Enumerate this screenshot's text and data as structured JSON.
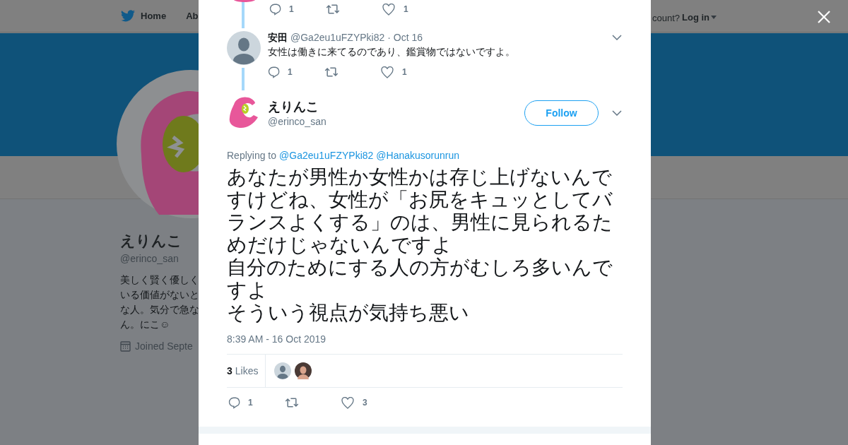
{
  "background_page": {
    "nav": [
      {
        "label": "Home",
        "selected": false
      },
      {
        "label": "Ab",
        "selected": false
      }
    ],
    "login_prompt": "count?",
    "login_link": "Log in",
    "profile": {
      "name": "えりんこ",
      "handle": "@erinco_san",
      "bio_lines": [
        "美しく賢く優しく",
        "いる価値がないと",
        "な人。気分で急な",
        "ん。にこ☺"
      ],
      "joined": "Joined Septe"
    }
  },
  "thread": [
    {
      "kind": "actions_only",
      "reply_count": "1",
      "like_count": "1"
    },
    {
      "kind": "reply",
      "name": "安田",
      "handle": "@Ga2eu1uFZYPki82",
      "date": "· Oct 16",
      "text": "女性は働きに来てるのであり、鑑賞物ではないですよ。",
      "reply_count": "1",
      "like_count": "1"
    }
  ],
  "tweet": {
    "name": "えりんこ",
    "handle": "@erinco_san",
    "follow_button": "Follow",
    "replying_label": "Replying to",
    "replying_to": [
      "@Ga2eu1uFZYPki82",
      "@Hanakusorunrun"
    ],
    "paragraphs": [
      "あなたが男性か女性かは存じ上げないんですけどね、女性が「お尻をキュッとしてバランスよくする」のは、男性に見られるためだけじゃないんですよ",
      "自分のためにする人の方がむしろ多いんですよ",
      "そういう視点が気持ち悪い"
    ],
    "timestamp": "8:39 AM - 16 Oct 2019",
    "likes_count": "3",
    "likes_label": "Likes",
    "reply_count": "1",
    "like_count": "3"
  }
}
